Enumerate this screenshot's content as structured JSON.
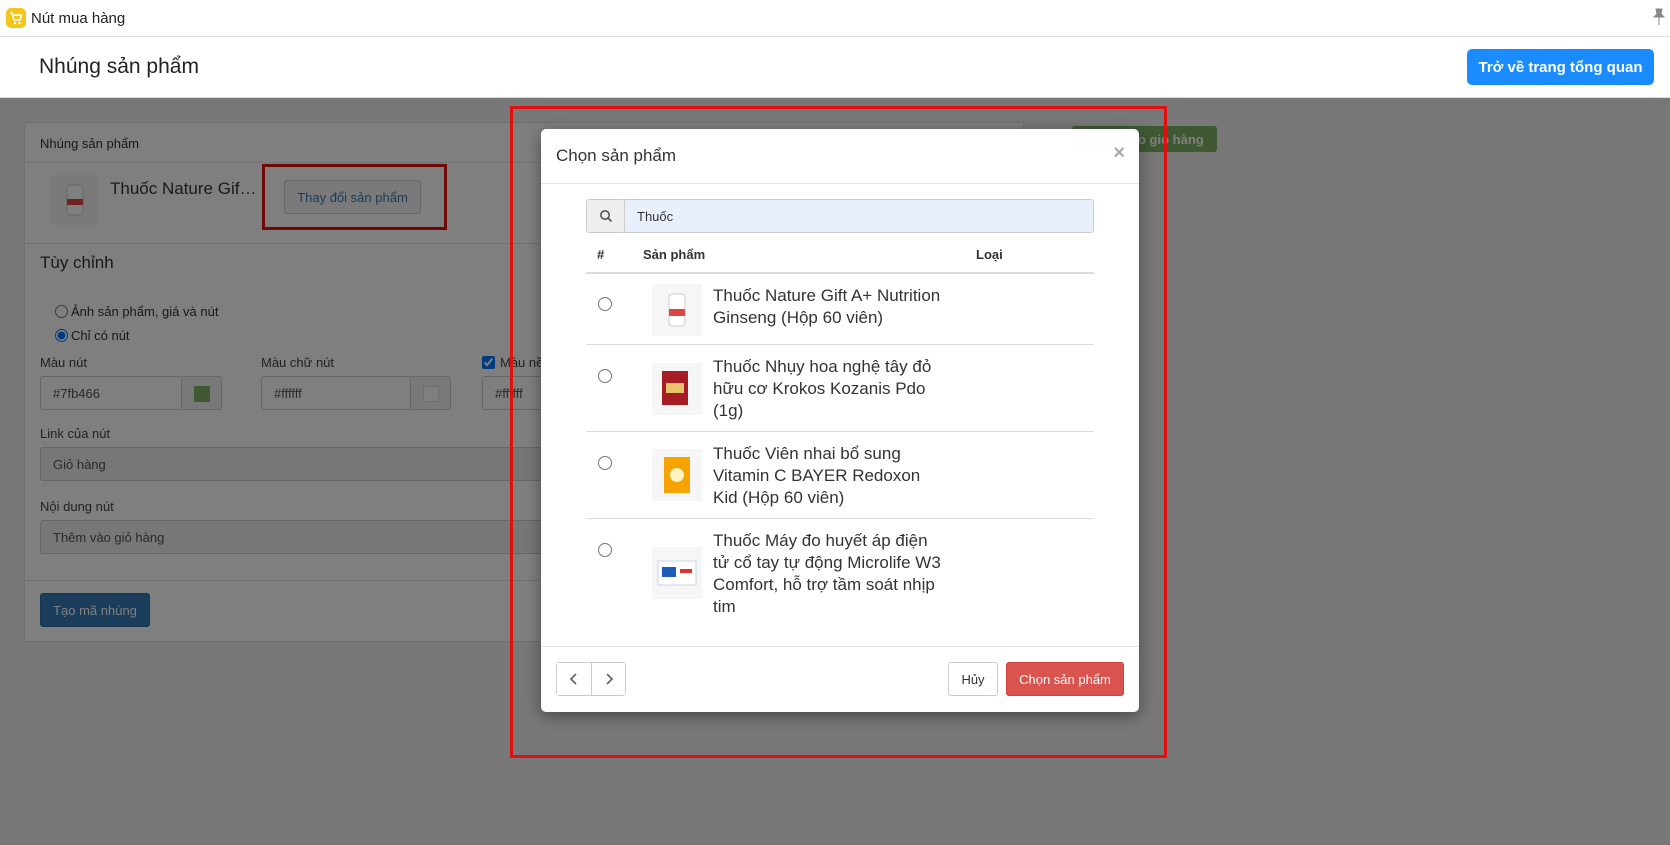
{
  "app": {
    "title": "Nút mua hàng",
    "logo_icon": "shopping-cart-icon",
    "pin_icon": "pin-icon"
  },
  "header": {
    "title": "Nhúng sản phẩm",
    "back_label": "Trở về trang tổng quan"
  },
  "card": {
    "head": "Nhúng sản phẩm",
    "product_name": "Thuốc Nature Gift A+ Nutrition Ginseng (Hộp 60 viên)",
    "change_label": "Thay đổi sản phẩm",
    "section": "Tùy chỉnh",
    "radio_full": "Ảnh sản phẩm, giá và nút",
    "radio_button_only": "Chỉ có nút",
    "button_color_label": "Màu nút",
    "button_color": "#7fb466",
    "text_color_label": "Màu chữ nút",
    "text_color": "#ffffff",
    "bg_color_label": "Màu nền",
    "bg_color": "#ffffff",
    "link_label": "Link của nút",
    "link_value": "Giỏ hàng",
    "content_label": "Nội dung nút",
    "content_value": "Thêm vào giỏ hàng",
    "generate_label": "Tạo mã nhúng",
    "preview_label": "Thêm vào giỏ hàng"
  },
  "modal": {
    "title": "Chọn sản phẩm",
    "close": "×",
    "search_value": "Thuốc",
    "columns": {
      "index": "#",
      "product": "Sản phẩm",
      "type": "Loại"
    },
    "rows": [
      {
        "name": "Thuốc Nature Gift A+ Nutrition Ginseng (Hộp 60 viên)",
        "type": ""
      },
      {
        "name": "Thuốc Nhụy hoa nghệ tây đỏ hữu cơ Krokos Kozanis Pdo (1g)",
        "type": ""
      },
      {
        "name": "Thuốc Viên nhai bổ sung Vitamin C BAYER Redoxon Kid (Hộp 60 viên)",
        "type": ""
      },
      {
        "name": "Thuốc Máy đo huyết áp điện tử cổ tay tự động Microlife W3 Comfort, hỗ trợ tầm soát nhịp tim",
        "type": ""
      }
    ],
    "cancel_label": "Hủy",
    "choose_label": "Chọn sản phẩm"
  },
  "colors": {
    "primary": "#1a8cff",
    "danger": "#d9534f",
    "accent_green": "#7fb466",
    "highlight": "#e01010"
  }
}
